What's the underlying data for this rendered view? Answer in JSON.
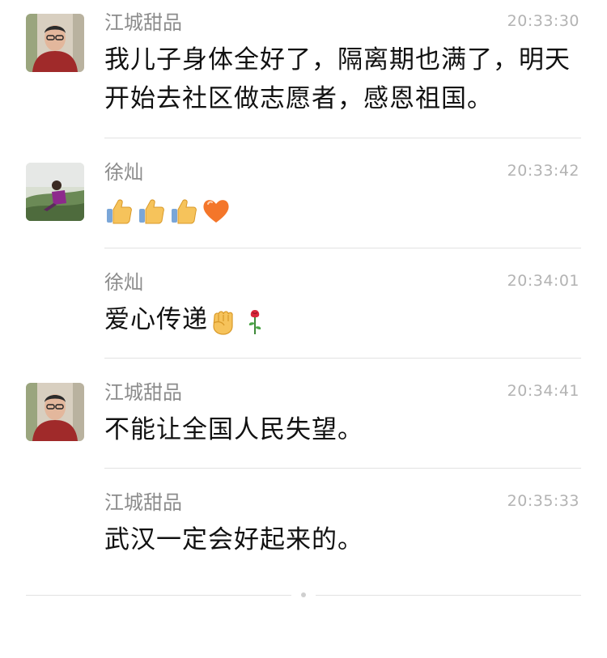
{
  "messages": [
    {
      "name": "江城甜品",
      "time": "20:33:30",
      "text": "我儿子身体全好了，隔离期也满了，明天开始去社区做志愿者，感恩祖国。"
    },
    {
      "name": "徐灿",
      "time": "20:33:42",
      "text": "",
      "emojis": [
        "thumbs-up",
        "thumbs-up",
        "thumbs-up",
        "orange-heart"
      ]
    },
    {
      "name": "徐灿",
      "time": "20:34:01",
      "text": "爱心传递",
      "emojis": [
        "fist",
        "rose"
      ]
    },
    {
      "name": "江城甜品",
      "time": "20:34:41",
      "text": "不能让全国人民失望。"
    },
    {
      "name": "江城甜品",
      "time": "20:35:33",
      "text": "武汉一定会好起来的。"
    }
  ],
  "colors": {
    "name": "#8c8c8c",
    "time": "#b3b3b3",
    "text": "#111111",
    "separator": "#e2e2e2"
  }
}
